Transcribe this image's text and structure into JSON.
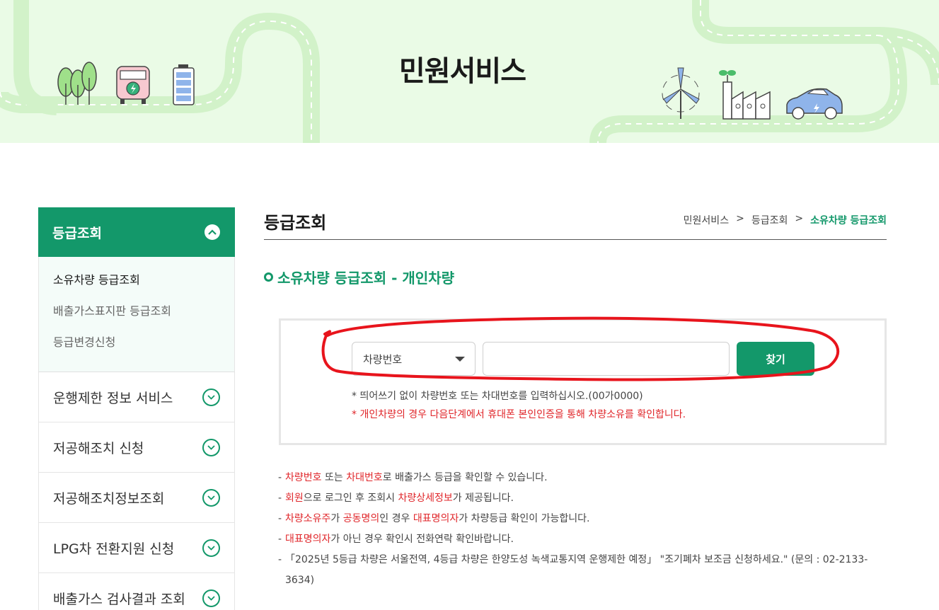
{
  "banner": {
    "title": "민원서비스"
  },
  "sidebar": {
    "header": {
      "label": "등급조회",
      "icon": "chevron-up-icon"
    },
    "sub_items": [
      {
        "label": "소유차량 등급조회",
        "active": true
      },
      {
        "label": "배출가스표지판 등급조회",
        "active": false
      },
      {
        "label": "등급변경신청",
        "active": false
      }
    ],
    "menu": [
      {
        "label": "운행제한 정보 서비스",
        "icon": "chevron-down-icon"
      },
      {
        "label": "저공해조치 신청",
        "icon": "chevron-down-icon"
      },
      {
        "label": "저공해조치정보조회",
        "icon": "chevron-down-icon"
      },
      {
        "label": "LPG차 전환지원 신청",
        "icon": "chevron-down-icon"
      },
      {
        "label": "배출가스 검사결과 조회",
        "icon": "chevron-down-icon"
      }
    ]
  },
  "main": {
    "title": "등급조회",
    "breadcrumb": [
      "민원서비스",
      "등급조회",
      "소유차량 등급조회"
    ],
    "breadcrumb_sep": ">",
    "section_title": "소유차량 등급조회 - 개인차량",
    "search": {
      "select_value": "차량번호",
      "input_value": "",
      "input_placeholder": "",
      "button_label": "찾기"
    },
    "notes": [
      "* 띄어쓰기 없이 차량번호 또는 차대번호를 입력하십시오.(00가0000)",
      "* 개인차량의 경우 다음단계에서 휴대폰 본인인증을 통해 차량소유를 확인합니다."
    ],
    "info": {
      "line1": {
        "a": "차량번호",
        "b": " 또는 ",
        "c": "차대번호",
        "d": "로 배출가스 등급을 확인할 수 있습니다."
      },
      "line2": {
        "a": "회원",
        "b": "으로 로그인 후 조회시 ",
        "c": "차량상세정보",
        "d": "가 제공됩니다."
      },
      "line3": {
        "a": "차량소유주",
        "b": "가 ",
        "c": "공동명의",
        "d": "인 경우 ",
        "e": "대표명의자",
        "f": "가 차량등급 확인이 가능합니다."
      },
      "line4": {
        "a": "대표명의자",
        "b": "가 아닌 경우 확인시 전화연락 확인바랍니다."
      },
      "line5": "「2025년 5등급 차량은 서울전역, 4등급 차량은 한양도성 녹색교통지역 운행제한 예정」 \"조기폐차 보조금 신청하세요.\" (문의 : 02-2133-3634)"
    },
    "dash": "-"
  },
  "colors": {
    "brand_green": "#13986a",
    "alert_red": "#e0262a",
    "banner_bg": "#eafbe6",
    "annotation_red": "#e8141c"
  }
}
